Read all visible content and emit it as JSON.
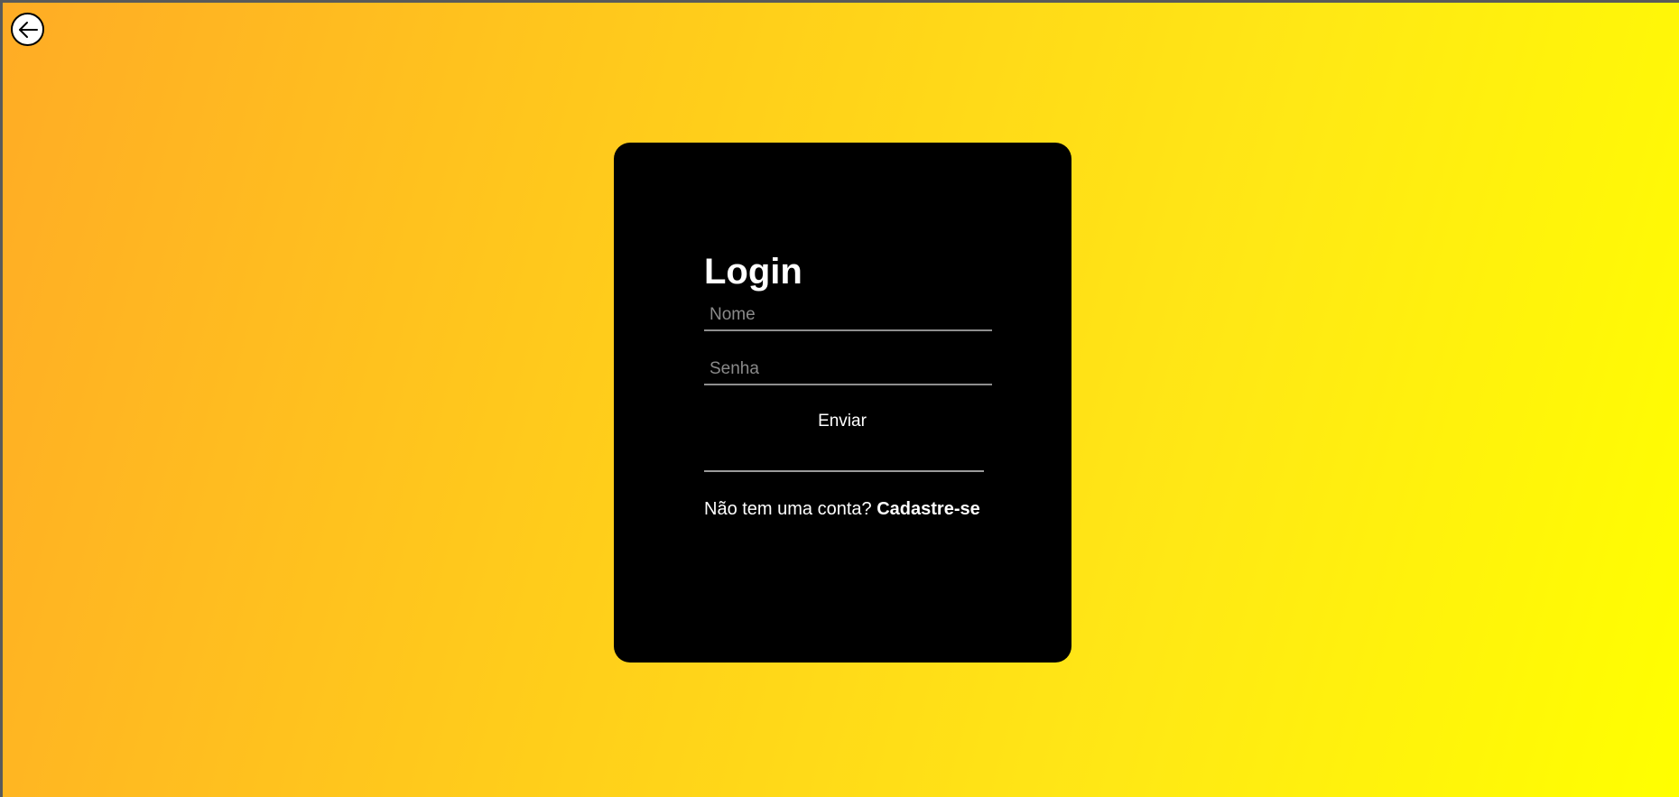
{
  "header": {
    "back_icon": "arrow-left-icon"
  },
  "login": {
    "title": "Login",
    "name_placeholder": "Nome",
    "password_placeholder": "Senha",
    "submit_label": "Enviar",
    "signup_prompt": "Não tem uma conta?",
    "signup_link": "Cadastre-se"
  },
  "colors": {
    "card_background": "#000000",
    "gradient_start": "#ffac25",
    "gradient_end": "#ffff00",
    "text": "#ffffff"
  }
}
